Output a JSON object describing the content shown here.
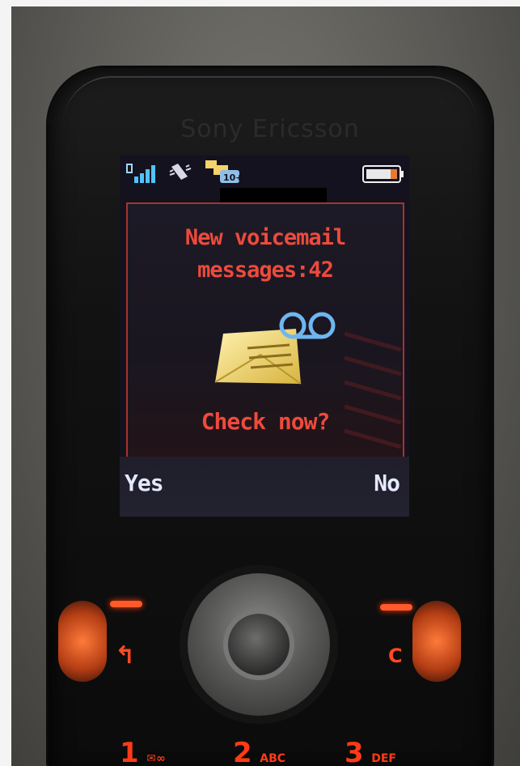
{
  "phone": {
    "brand": "Sony Ericsson"
  },
  "screen": {
    "message_line1": "New voicemail",
    "message_line2": "messages:42",
    "prompt": "Check now?",
    "softkey_left": "Yes",
    "softkey_right": "No",
    "status_icons": [
      "signal-strength-icon",
      "vibrate-icon",
      "voicemail-notification-icon",
      "battery-icon"
    ],
    "colors": {
      "message_text": "#ee4a3c",
      "softkey_text": "#e6e8ff",
      "dialog_border": "#a8332e"
    }
  },
  "keypad": {
    "back_symbol": "↰",
    "clear_label": "C",
    "keys": [
      {
        "digit": "1",
        "letters": ""
      },
      {
        "digit": "2",
        "letters": "ABC"
      },
      {
        "digit": "3",
        "letters": "DEF"
      }
    ]
  }
}
